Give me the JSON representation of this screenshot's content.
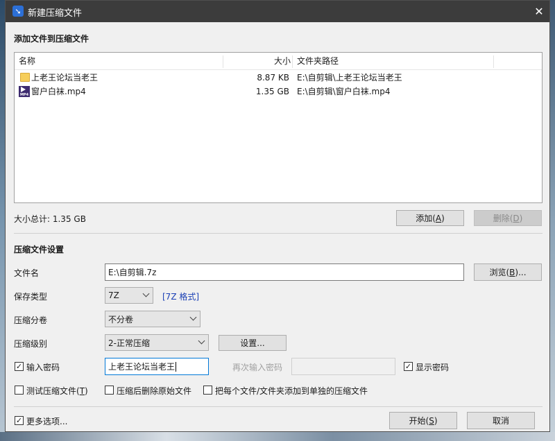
{
  "window": {
    "title": "新建压缩文件",
    "close_glyph": "✕"
  },
  "section_add": {
    "title": "添加文件到压缩文件"
  },
  "file_list": {
    "columns": {
      "name": "名称",
      "size": "大小",
      "path": "文件夹路径"
    },
    "rows": [
      {
        "icon": "folder-icon",
        "name": "上老王论坛当老王",
        "size": "8.87 KB",
        "path": "E:\\自剪辑\\上老王论坛当老王"
      },
      {
        "icon": "mp4-file-icon",
        "icon_text": "MP4",
        "name": "窗户白袜.mp4",
        "size": "1.35 GB",
        "path": "E:\\自剪辑\\窗户白袜.mp4"
      }
    ]
  },
  "total_size": "大小总计: 1.35 GB",
  "buttons": {
    "add": {
      "label": "添加(",
      "key": "A",
      "suffix": ")"
    },
    "delete": {
      "label": "删除(",
      "key": "D",
      "suffix": ")"
    },
    "browse": {
      "label": "浏览(",
      "key": "B",
      "suffix": ")..."
    },
    "settings": "设置...",
    "start": {
      "label": "开始(",
      "key": "S",
      "suffix": ")"
    },
    "cancel": "取消"
  },
  "section_settings": {
    "title": "压缩文件设置"
  },
  "form": {
    "filename_label": "文件名",
    "filename_value": "E:\\自剪辑.7z",
    "save_type_label": "保存类型",
    "save_type_value": "7Z",
    "save_type_link": "[7Z 格式]",
    "split_label": "压缩分卷",
    "split_value": "不分卷",
    "level_label": "压缩级别",
    "level_value": "2-正常压缩",
    "password_label": "输入密码",
    "password_value": "上老王论坛当老王",
    "confirm_password_label": "再次输入密码",
    "confirm_password_value": "",
    "show_password_label": "显示密码",
    "test_archive_label": "测试压缩文件(",
    "test_archive_key": "T",
    "test_archive_suffix": ")",
    "delete_after_label": "压缩后删除原始文件",
    "separate_archives_label": "把每个文件/文件夹添加到单独的压缩文件",
    "more_options_label": "更多选项..."
  },
  "checks": {
    "password": true,
    "show_password": true,
    "test_archive": false,
    "delete_after": false,
    "separate_archives": false,
    "more_options": true
  },
  "check_glyph": "✓"
}
